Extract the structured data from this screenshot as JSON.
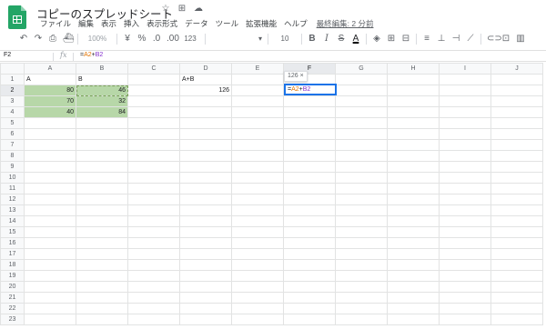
{
  "title": "コピーのスプレッドシート",
  "title_icons": [
    "star-icon",
    "move-to-folder-icon",
    "cloud-status-icon"
  ],
  "menu": [
    "ファイル",
    "編集",
    "表示",
    "挿入",
    "表示形式",
    "データ",
    "ツール",
    "拡張機能",
    "ヘルプ"
  ],
  "last_edit": "最終編集: 2 分前",
  "toolbar": {
    "undo": "↶",
    "redo": "↷",
    "print": "⎙",
    "paint": "⛴",
    "zoom": "100%",
    "currency": "¥",
    "percent": "%",
    "dec_less": ".0",
    "dec_more": ".00",
    "format": "123",
    "font": "",
    "size": "10",
    "minus": "−",
    "plus": "+",
    "bold": "B",
    "italic": "I",
    "strike": "S",
    "text_color": "A",
    "fill": "◈",
    "borders": "⊞",
    "merge": "⊟",
    "h_align": "≡",
    "v_align": "⊥",
    "wrap": "⊣",
    "rotate": "⟋",
    "link": "⊂⊃",
    "comment": "⊡",
    "chart": "▥"
  },
  "formula_bar": {
    "cell": "F2",
    "fx": "fx",
    "formula_eq": "=",
    "formula_a": "A2",
    "formula_plus": "+",
    "formula_b": "B2"
  },
  "columns": [
    "A",
    "B",
    "C",
    "D",
    "E",
    "F",
    "G",
    "H",
    "I",
    "J"
  ],
  "rows": [
    "1",
    "2",
    "3",
    "4",
    "5",
    "6",
    "7",
    "8",
    "9",
    "10",
    "11",
    "12",
    "13",
    "14",
    "15",
    "16",
    "17",
    "18",
    "19",
    "20",
    "21",
    "22",
    "23"
  ],
  "cells": {
    "A1": "A",
    "B1": "B",
    "D1": "A+B",
    "A2": "80",
    "B2": "46",
    "D2": "126",
    "A3": "70",
    "B3": "32",
    "A4": "40",
    "B4": "84"
  },
  "tooltip": "126",
  "tooltip_close": "×",
  "colors": {
    "green_fill": "#b7d7a8",
    "selection": "#1a73e8",
    "brand": "#23a566"
  }
}
